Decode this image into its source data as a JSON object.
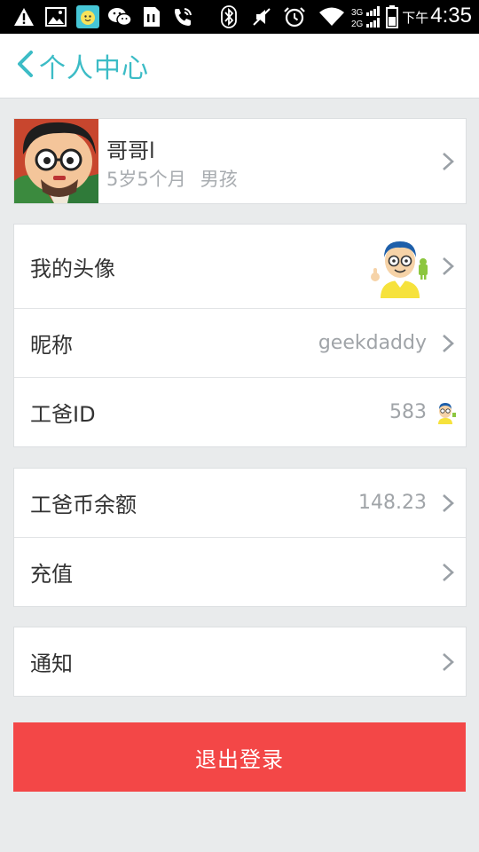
{
  "status_bar": {
    "time_prefix": "下午",
    "time": "4:35",
    "network_label_top": "3G",
    "network_label_bottom": "2G",
    "icons": [
      "warning-icon",
      "image-icon",
      "baby-app-icon",
      "wechat-icon",
      "sim-icon",
      "phone-call-icon",
      "bluetooth-icon",
      "mute-icon",
      "alarm-icon",
      "wifi-icon",
      "signal-icon",
      "battery-icon"
    ]
  },
  "header": {
    "title": "个人中心",
    "accent_color": "#3cbcc6"
  },
  "profile": {
    "name": "哥哥l",
    "age": "5岁5个月",
    "gender": "男孩"
  },
  "account": {
    "avatar_label": "我的头像",
    "nickname_label": "昵称",
    "nickname_value": "geekdaddy",
    "id_label": "工爸ID",
    "id_value": "583"
  },
  "wallet": {
    "balance_label": "工爸币余额",
    "balance_value": "148.23",
    "recharge_label": "充值"
  },
  "notify": {
    "label": "通知"
  },
  "logout": {
    "label": "退出登录",
    "color": "#f34747"
  }
}
